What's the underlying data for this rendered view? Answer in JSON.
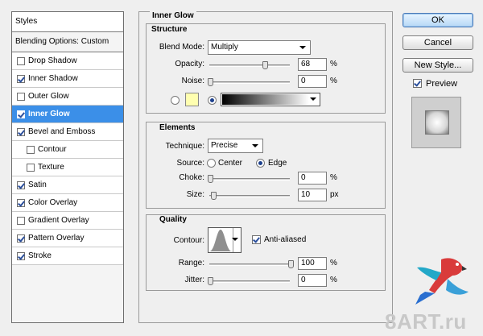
{
  "sidebar": {
    "header": "Styles",
    "blending": "Blending Options: Custom",
    "items": [
      {
        "label": "Drop Shadow",
        "checked": false
      },
      {
        "label": "Inner Shadow",
        "checked": true
      },
      {
        "label": "Outer Glow",
        "checked": false
      },
      {
        "label": "Inner Glow",
        "checked": true,
        "active": true
      },
      {
        "label": "Bevel and Emboss",
        "checked": true
      },
      {
        "label": "Contour",
        "checked": false,
        "sub": true
      },
      {
        "label": "Texture",
        "checked": false,
        "sub": true
      },
      {
        "label": "Satin",
        "checked": true
      },
      {
        "label": "Color Overlay",
        "checked": true
      },
      {
        "label": "Gradient Overlay",
        "checked": false
      },
      {
        "label": "Pattern Overlay",
        "checked": true
      },
      {
        "label": "Stroke",
        "checked": true
      }
    ]
  },
  "panel": {
    "title": "Inner Glow",
    "structure": {
      "title": "Structure",
      "blend_mode_label": "Blend Mode:",
      "blend_mode_value": "Multiply",
      "opacity_label": "Opacity:",
      "opacity_value": "68",
      "opacity_unit": "%",
      "opacity_level": 0.68,
      "noise_label": "Noise:",
      "noise_value": "0",
      "noise_unit": "%",
      "noise_level": 0,
      "color_swatch": "#ffffb0"
    },
    "elements": {
      "title": "Elements",
      "technique_label": "Technique:",
      "technique_value": "Precise",
      "source_label": "Source:",
      "source_center": "Center",
      "source_edge": "Edge",
      "source_selected": "Edge",
      "choke_label": "Choke:",
      "choke_value": "0",
      "choke_unit": "%",
      "choke_level": 0,
      "size_label": "Size:",
      "size_value": "10",
      "size_unit": "px",
      "size_level": 0.04
    },
    "quality": {
      "title": "Quality",
      "contour_label": "Contour:",
      "anti_aliased_label": "Anti-aliased",
      "anti_aliased": true,
      "range_label": "Range:",
      "range_value": "100",
      "range_unit": "%",
      "range_level": 1.0,
      "jitter_label": "Jitter:",
      "jitter_value": "0",
      "jitter_unit": "%",
      "jitter_level": 0
    }
  },
  "buttons": {
    "ok": "OK",
    "cancel": "Cancel",
    "new_style": "New Style...",
    "preview_label": "Preview",
    "preview_checked": true
  },
  "watermark": "8ART.ru"
}
